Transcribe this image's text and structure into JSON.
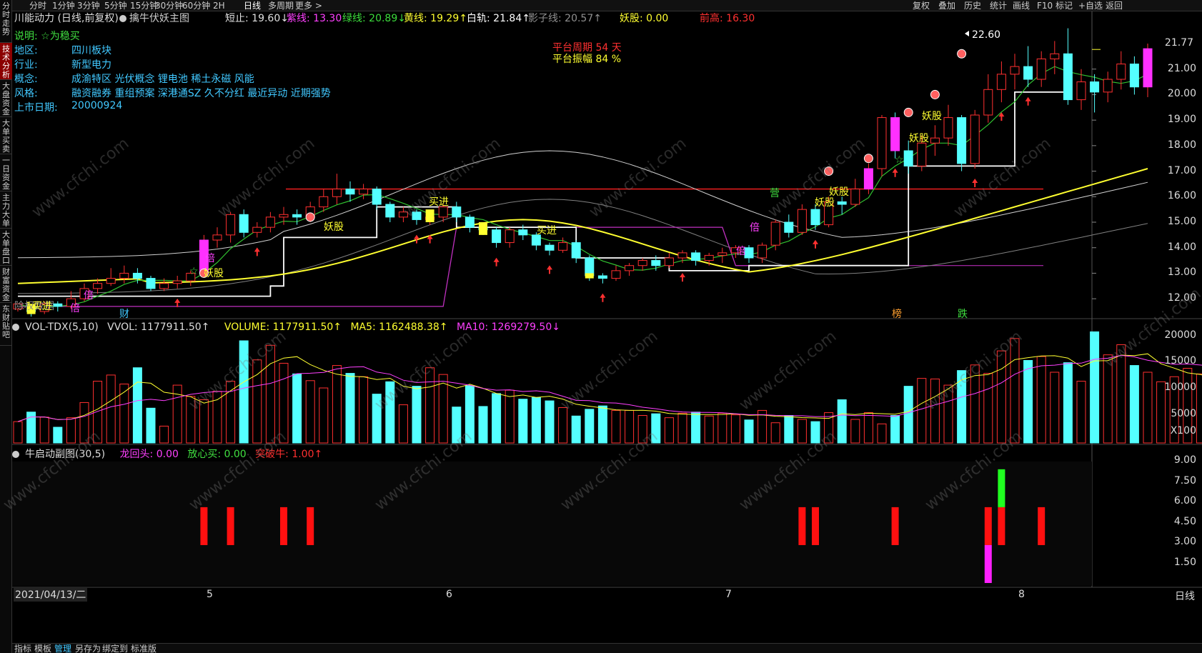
{
  "left_tabs": [
    "分时走势",
    "技术分析",
    "大盘资金",
    "大单买卖",
    "一日资金",
    "主力大单",
    "大单盘口",
    "财富资金",
    "东财贴吧"
  ],
  "periods": [
    "分时",
    "1分钟",
    "3分钟",
    "5分钟",
    "15分钟",
    "30分钟",
    "60分钟",
    "2H",
    "日线",
    "多周期",
    "更多 >"
  ],
  "right_tools": [
    "复权",
    "叠加",
    "历史",
    "统计",
    "画线",
    "F10",
    "标记",
    "+自选",
    "返回"
  ],
  "header": {
    "stock": "川能动力 (日线,前复权)",
    "indicator": "擒牛伏妖主图",
    "items": [
      {
        "text": "短止: 19.60↓",
        "color": "#e0e0e0"
      },
      {
        "text": "紫线: 13.30",
        "color": "#ff40ff"
      },
      {
        "text": "绿线: 20.89↓",
        "color": "#3cdc3c"
      },
      {
        "text": "黄线: 19.29↑",
        "color": "#ffff30"
      },
      {
        "text": "白轨: 21.84↑",
        "color": "#ffffff"
      },
      {
        "text": "影子线: 20.57↑",
        "color": "#909090"
      },
      {
        "text": "妖股: 0.00",
        "color": "#ffff30"
      },
      {
        "text": "前高: 16.30",
        "color": "#ff3030"
      }
    ]
  },
  "info": {
    "note": "说明: ☆为稳买",
    "rows": [
      {
        "label": "地区:",
        "value": "四川板块"
      },
      {
        "label": "行业:",
        "value": "新型电力"
      },
      {
        "label": "概念:",
        "value": "成渝特区 光伏概念 锂电池 稀土永磁 风能"
      },
      {
        "label": "风格:",
        "value": "融资融券 重组预案 深港通SZ 久不分红 最近异动 近期强势"
      },
      {
        "label": "上市日期:",
        "value": "20000924"
      }
    ]
  },
  "platform": {
    "period": "平台周期 54 天",
    "amplitude": "平台振幅 84 %"
  },
  "price_axis": [
    "21.00",
    "20.00",
    "19.00",
    "18.00",
    "17.00",
    "16.00",
    "15.00",
    "14.00",
    "13.00",
    "12.00"
  ],
  "price_current": "21.77",
  "price_high_label": "22.60",
  "chart_labels": {
    "yaogu": "妖股",
    "buyin": "买进",
    "bei": "倍",
    "ying": "营",
    "cai": "财",
    "bang": "榜",
    "die": "跌",
    "star": "☆",
    "fenhong": "除权数据",
    "fenhong2": "1买进"
  },
  "volume_panel": {
    "title": "VOL-TDX(5,10)",
    "vvol": "VVOL: 1177911.50↑",
    "volume": "VOLUME: 1177911.50↑",
    "ma5": "MA5: 1162488.38↑",
    "ma10": "MA10: 1269279.50↓",
    "axis": [
      "20000",
      "15000",
      "10000",
      "5000",
      "X100"
    ]
  },
  "sub_panel": {
    "title": "牛启动副图(30,5)",
    "longhuitou": "龙回头: 0.00",
    "fangxin": "放心买: 0.00",
    "tupo": "突破牛: 1.00↑",
    "axis": [
      "9.00",
      "7.50",
      "6.00",
      "4.50",
      "3.00",
      "1.50"
    ]
  },
  "time_axis": {
    "date": "2021/04/13/二",
    "months": [
      "5",
      "6",
      "7",
      "8"
    ],
    "period": "日线"
  },
  "bottom_tabs": [
    "指标",
    "模板",
    "管理",
    "另存为",
    "绑定到",
    "标准版"
  ],
  "watermark": "www.cfchi.com",
  "chart_data": [
    {
      "type": "candlestick",
      "title": "擒牛伏妖主图",
      "ylim": [
        11.5,
        22.7
      ],
      "series": [
        {
          "name": "紫线",
          "values_note": "step line"
        },
        {
          "name": "绿线"
        },
        {
          "name": "黄线"
        },
        {
          "name": "白轨"
        },
        {
          "name": "影子线"
        },
        {
          "name": "前高",
          "value": 16.3
        }
      ],
      "candles": [
        [
          11.6,
          11.8,
          11.5,
          11.7
        ],
        [
          11.7,
          11.5,
          11.3,
          11.8
        ],
        [
          11.5,
          11.8,
          11.4,
          11.9
        ],
        [
          11.8,
          11.7,
          11.5,
          11.9
        ],
        [
          11.7,
          12.0,
          11.6,
          12.3
        ],
        [
          12.0,
          12.4,
          11.9,
          12.6
        ],
        [
          12.4,
          12.6,
          12.2,
          12.8
        ],
        [
          12.6,
          12.8,
          12.5,
          13.2
        ],
        [
          12.8,
          13.0,
          12.6,
          13.3
        ],
        [
          13.0,
          12.8,
          12.6,
          13.2
        ],
        [
          12.8,
          12.4,
          12.3,
          12.9
        ],
        [
          12.4,
          12.6,
          12.3,
          12.8
        ],
        [
          12.6,
          12.7,
          12.4,
          12.9
        ],
        [
          12.7,
          13.0,
          12.5,
          13.1
        ],
        [
          13.0,
          14.3,
          12.9,
          14.5
        ],
        [
          14.3,
          14.5,
          14.0,
          14.8
        ],
        [
          14.5,
          15.3,
          14.2,
          15.4
        ],
        [
          15.3,
          14.6,
          14.4,
          15.5
        ],
        [
          14.6,
          14.8,
          14.4,
          15.0
        ],
        [
          14.8,
          15.2,
          14.6,
          15.4
        ],
        [
          15.2,
          15.3,
          14.9,
          15.6
        ],
        [
          15.3,
          15.2,
          14.9,
          15.5
        ],
        [
          15.2,
          15.6,
          15.0,
          15.8
        ],
        [
          15.6,
          16.0,
          15.4,
          16.3
        ],
        [
          16.0,
          16.3,
          15.7,
          16.9
        ],
        [
          16.3,
          16.1,
          15.8,
          16.6
        ],
        [
          16.1,
          16.3,
          15.9,
          16.5
        ],
        [
          16.3,
          15.7,
          15.5,
          16.4
        ],
        [
          15.7,
          15.2,
          15.0,
          15.8
        ],
        [
          15.2,
          15.4,
          15.0,
          15.6
        ],
        [
          15.4,
          15.1,
          14.9,
          15.5
        ],
        [
          15.1,
          15.2,
          14.9,
          15.4
        ],
        [
          15.2,
          15.6,
          15.0,
          15.7
        ],
        [
          15.6,
          15.2,
          15.0,
          15.8
        ],
        [
          15.2,
          14.8,
          14.6,
          15.3
        ],
        [
          14.8,
          14.7,
          14.5,
          15.0
        ],
        [
          14.7,
          14.2,
          14.0,
          14.8
        ],
        [
          14.2,
          14.7,
          14.0,
          14.8
        ],
        [
          14.7,
          14.5,
          14.3,
          14.9
        ],
        [
          14.5,
          14.1,
          13.9,
          14.6
        ],
        [
          14.1,
          13.9,
          13.7,
          14.2
        ],
        [
          13.9,
          14.2,
          13.8,
          14.4
        ],
        [
          14.2,
          13.6,
          13.4,
          14.3
        ],
        [
          13.6,
          12.9,
          12.7,
          13.7
        ],
        [
          12.9,
          12.8,
          12.6,
          13.0
        ],
        [
          12.8,
          13.1,
          12.7,
          13.3
        ],
        [
          13.1,
          13.3,
          12.9,
          13.4
        ],
        [
          13.3,
          13.5,
          13.1,
          13.6
        ],
        [
          13.5,
          13.3,
          13.1,
          13.7
        ],
        [
          13.3,
          13.6,
          13.2,
          13.8
        ],
        [
          13.6,
          13.8,
          13.4,
          13.9
        ],
        [
          13.8,
          13.5,
          13.3,
          13.9
        ],
        [
          13.5,
          13.7,
          13.3,
          13.8
        ],
        [
          13.7,
          13.8,
          13.4,
          14.0
        ],
        [
          13.8,
          14.0,
          13.6,
          14.1
        ],
        [
          14.0,
          13.6,
          13.4,
          14.1
        ],
        [
          13.6,
          14.1,
          13.4,
          14.2
        ],
        [
          14.1,
          15.0,
          13.9,
          15.1
        ],
        [
          15.0,
          14.6,
          14.4,
          15.3
        ],
        [
          14.6,
          15.5,
          14.5,
          15.7
        ],
        [
          15.5,
          14.9,
          14.7,
          15.7
        ],
        [
          14.9,
          15.8,
          14.8,
          16.0
        ],
        [
          15.8,
          15.7,
          15.3,
          16.0
        ],
        [
          15.7,
          16.3,
          15.6,
          16.7
        ],
        [
          16.3,
          17.1,
          16.1,
          17.3
        ],
        [
          17.1,
          19.1,
          16.8,
          19.2
        ],
        [
          19.1,
          17.8,
          17.5,
          19.3
        ],
        [
          17.8,
          17.2,
          16.9,
          18.2
        ],
        [
          17.2,
          18.1,
          17.0,
          18.4
        ],
        [
          18.1,
          18.3,
          17.6,
          18.8
        ],
        [
          18.3,
          19.1,
          18.0,
          19.6
        ],
        [
          19.1,
          17.3,
          17.0,
          19.2
        ],
        [
          17.3,
          19.2,
          17.1,
          19.4
        ],
        [
          19.2,
          20.2,
          18.9,
          20.8
        ],
        [
          20.2,
          20.8,
          19.7,
          21.3
        ],
        [
          20.8,
          21.1,
          20.2,
          21.6
        ],
        [
          21.1,
          20.6,
          20.3,
          21.9
        ],
        [
          20.6,
          21.4,
          20.3,
          21.7
        ],
        [
          21.4,
          21.6,
          20.8,
          22.1
        ],
        [
          21.6,
          19.8,
          19.6,
          22.6
        ],
        [
          19.8,
          20.5,
          19.4,
          21.0
        ],
        [
          20.5,
          20.1,
          19.3,
          20.8
        ],
        [
          20.1,
          20.6,
          19.7,
          20.9
        ],
        [
          20.6,
          21.2,
          20.2,
          21.7
        ],
        [
          21.2,
          20.3,
          20.0,
          21.5
        ],
        [
          20.3,
          21.8,
          19.9,
          22.0
        ]
      ]
    },
    {
      "type": "bar",
      "title": "VOL-TDX(5,10)",
      "ylim": [
        0,
        21000
      ],
      "values": [
        3800,
        5500,
        4600,
        2800,
        4500,
        7200,
        11000,
        12100,
        10500,
        13400,
        6200,
        3000,
        10300,
        8300,
        7700,
        9200,
        11000,
        18200,
        14800,
        17400,
        14200,
        12300,
        11100,
        9800,
        13800,
        12400,
        11800,
        8700,
        10900,
        6800,
        10100,
        13400,
        12200,
        6400,
        10200,
        6500,
        8800,
        9400,
        7800,
        8100,
        7500,
        6300,
        4800,
        6000,
        6600,
        5800,
        5800,
        4900,
        5200,
        4500,
        5300,
        5500,
        4800,
        5300,
        5000,
        4100,
        5800,
        3600,
        4900,
        4200,
        3800,
        5400,
        7700,
        4200,
        5400,
        3400,
        4900,
        10100,
        11500,
        11400,
        10300,
        12900,
        13900,
        12400,
        16400,
        18600,
        14700,
        15400,
        12600,
        14300,
        11000,
        19800,
        15700,
        17500,
        13800,
        12600,
        10900,
        11800,
        13300,
        12300,
        8800,
        11900
      ]
    },
    {
      "type": "bar",
      "title": "牛启动副图(30,5)",
      "ylim": [
        0,
        9.5
      ],
      "values_note": "red signals at 6.0 level, magenta at 3.0, green at 9.0"
    }
  ]
}
